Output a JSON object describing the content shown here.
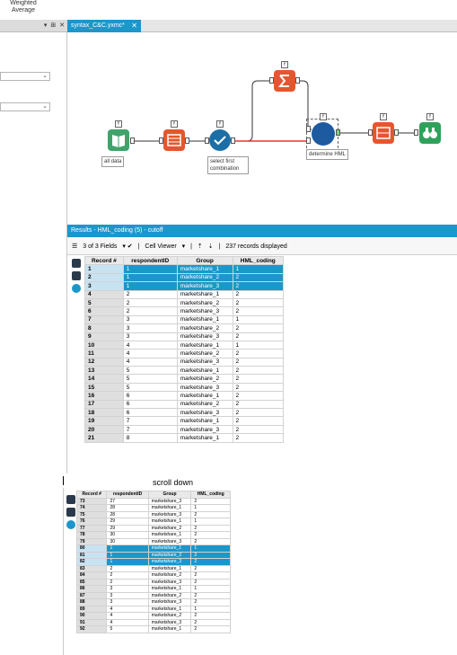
{
  "toolbar_label": {
    "line1": "Weighted",
    "line2": "Average"
  },
  "left_pane": {
    "controls": "▾ ⊞ ✕"
  },
  "workflow_tab": {
    "label": "syntax_C&C.yxmc*",
    "close": "✕"
  },
  "canvas": {
    "tag_label": "f",
    "notes": {
      "input": "all data",
      "select": "select first combination",
      "join": "determine HML"
    }
  },
  "results": {
    "title": "Results - HML_coding (5) - cutoff",
    "fields_label": "3 of 3 Fields",
    "viewer_label": "Cell Viewer",
    "records_label": "237 records displayed",
    "columns": [
      "Record #",
      "respondentID",
      "Group",
      "HML_coding"
    ],
    "rows": [
      [
        "1",
        "1",
        "marketshare_1",
        "1"
      ],
      [
        "2",
        "1",
        "marketshare_2",
        "2"
      ],
      [
        "3",
        "1",
        "marketshare_3",
        "2"
      ],
      [
        "4",
        "2",
        "marketshare_1",
        "2"
      ],
      [
        "5",
        "2",
        "marketshare_2",
        "2"
      ],
      [
        "6",
        "2",
        "marketshare_3",
        "2"
      ],
      [
        "7",
        "3",
        "marketshare_1",
        "1"
      ],
      [
        "8",
        "3",
        "marketshare_2",
        "2"
      ],
      [
        "9",
        "3",
        "marketshare_3",
        "2"
      ],
      [
        "10",
        "4",
        "marketshare_1",
        "1"
      ],
      [
        "11",
        "4",
        "marketshare_2",
        "2"
      ],
      [
        "12",
        "4",
        "marketshare_3",
        "2"
      ],
      [
        "13",
        "5",
        "marketshare_1",
        "2"
      ],
      [
        "14",
        "5",
        "marketshare_2",
        "2"
      ],
      [
        "15",
        "5",
        "marketshare_3",
        "2"
      ],
      [
        "16",
        "6",
        "marketshare_1",
        "2"
      ],
      [
        "17",
        "6",
        "marketshare_2",
        "2"
      ],
      [
        "18",
        "6",
        "marketshare_3",
        "2"
      ],
      [
        "19",
        "7",
        "marketshare_1",
        "2"
      ],
      [
        "20",
        "7",
        "marketshare_3",
        "2"
      ],
      [
        "21",
        "8",
        "marketshare_1",
        "2"
      ]
    ],
    "selected_rows": [
      0,
      1,
      2
    ]
  },
  "caption": "scroll down",
  "results_scrolled": {
    "columns": [
      "Record #",
      "respondentID",
      "Group",
      "HML_coding"
    ],
    "rows": [
      [
        "73",
        "27",
        "marketshare_3",
        "2"
      ],
      [
        "74",
        "28",
        "marketshare_1",
        "1"
      ],
      [
        "75",
        "28",
        "marketshare_3",
        "2"
      ],
      [
        "76",
        "29",
        "marketshare_1",
        "1"
      ],
      [
        "77",
        "29",
        "marketshare_2",
        "2"
      ],
      [
        "78",
        "30",
        "marketshare_1",
        "2"
      ],
      [
        "79",
        "30",
        "marketshare_3",
        "2"
      ],
      [
        "80",
        "1",
        "marketshare_1",
        "1"
      ],
      [
        "81",
        "1",
        "marketshare_2",
        "2"
      ],
      [
        "82",
        "1",
        "marketshare_3",
        "2"
      ],
      [
        "83",
        "2",
        "marketshare_1",
        "2"
      ],
      [
        "84",
        "2",
        "marketshare_2",
        "2"
      ],
      [
        "85",
        "2",
        "marketshare_3",
        "2"
      ],
      [
        "86",
        "3",
        "marketshare_1",
        "1"
      ],
      [
        "87",
        "3",
        "marketshare_2",
        "2"
      ],
      [
        "88",
        "3",
        "marketshare_3",
        "2"
      ],
      [
        "89",
        "4",
        "marketshare_1",
        "1"
      ],
      [
        "90",
        "4",
        "marketshare_2",
        "2"
      ],
      [
        "91",
        "4",
        "marketshare_3",
        "2"
      ],
      [
        "92",
        "5",
        "marketshare_1",
        "2"
      ]
    ],
    "selected_rows": [
      7,
      8,
      9
    ]
  },
  "colors": {
    "accent": "#1c97c9",
    "input_tool": "#3fa36b",
    "formula_tool": "#e4572e",
    "select_tool": "#1c6fa6",
    "join_tool": "#1d5aa0",
    "browse_tool": "#2fa15b"
  }
}
